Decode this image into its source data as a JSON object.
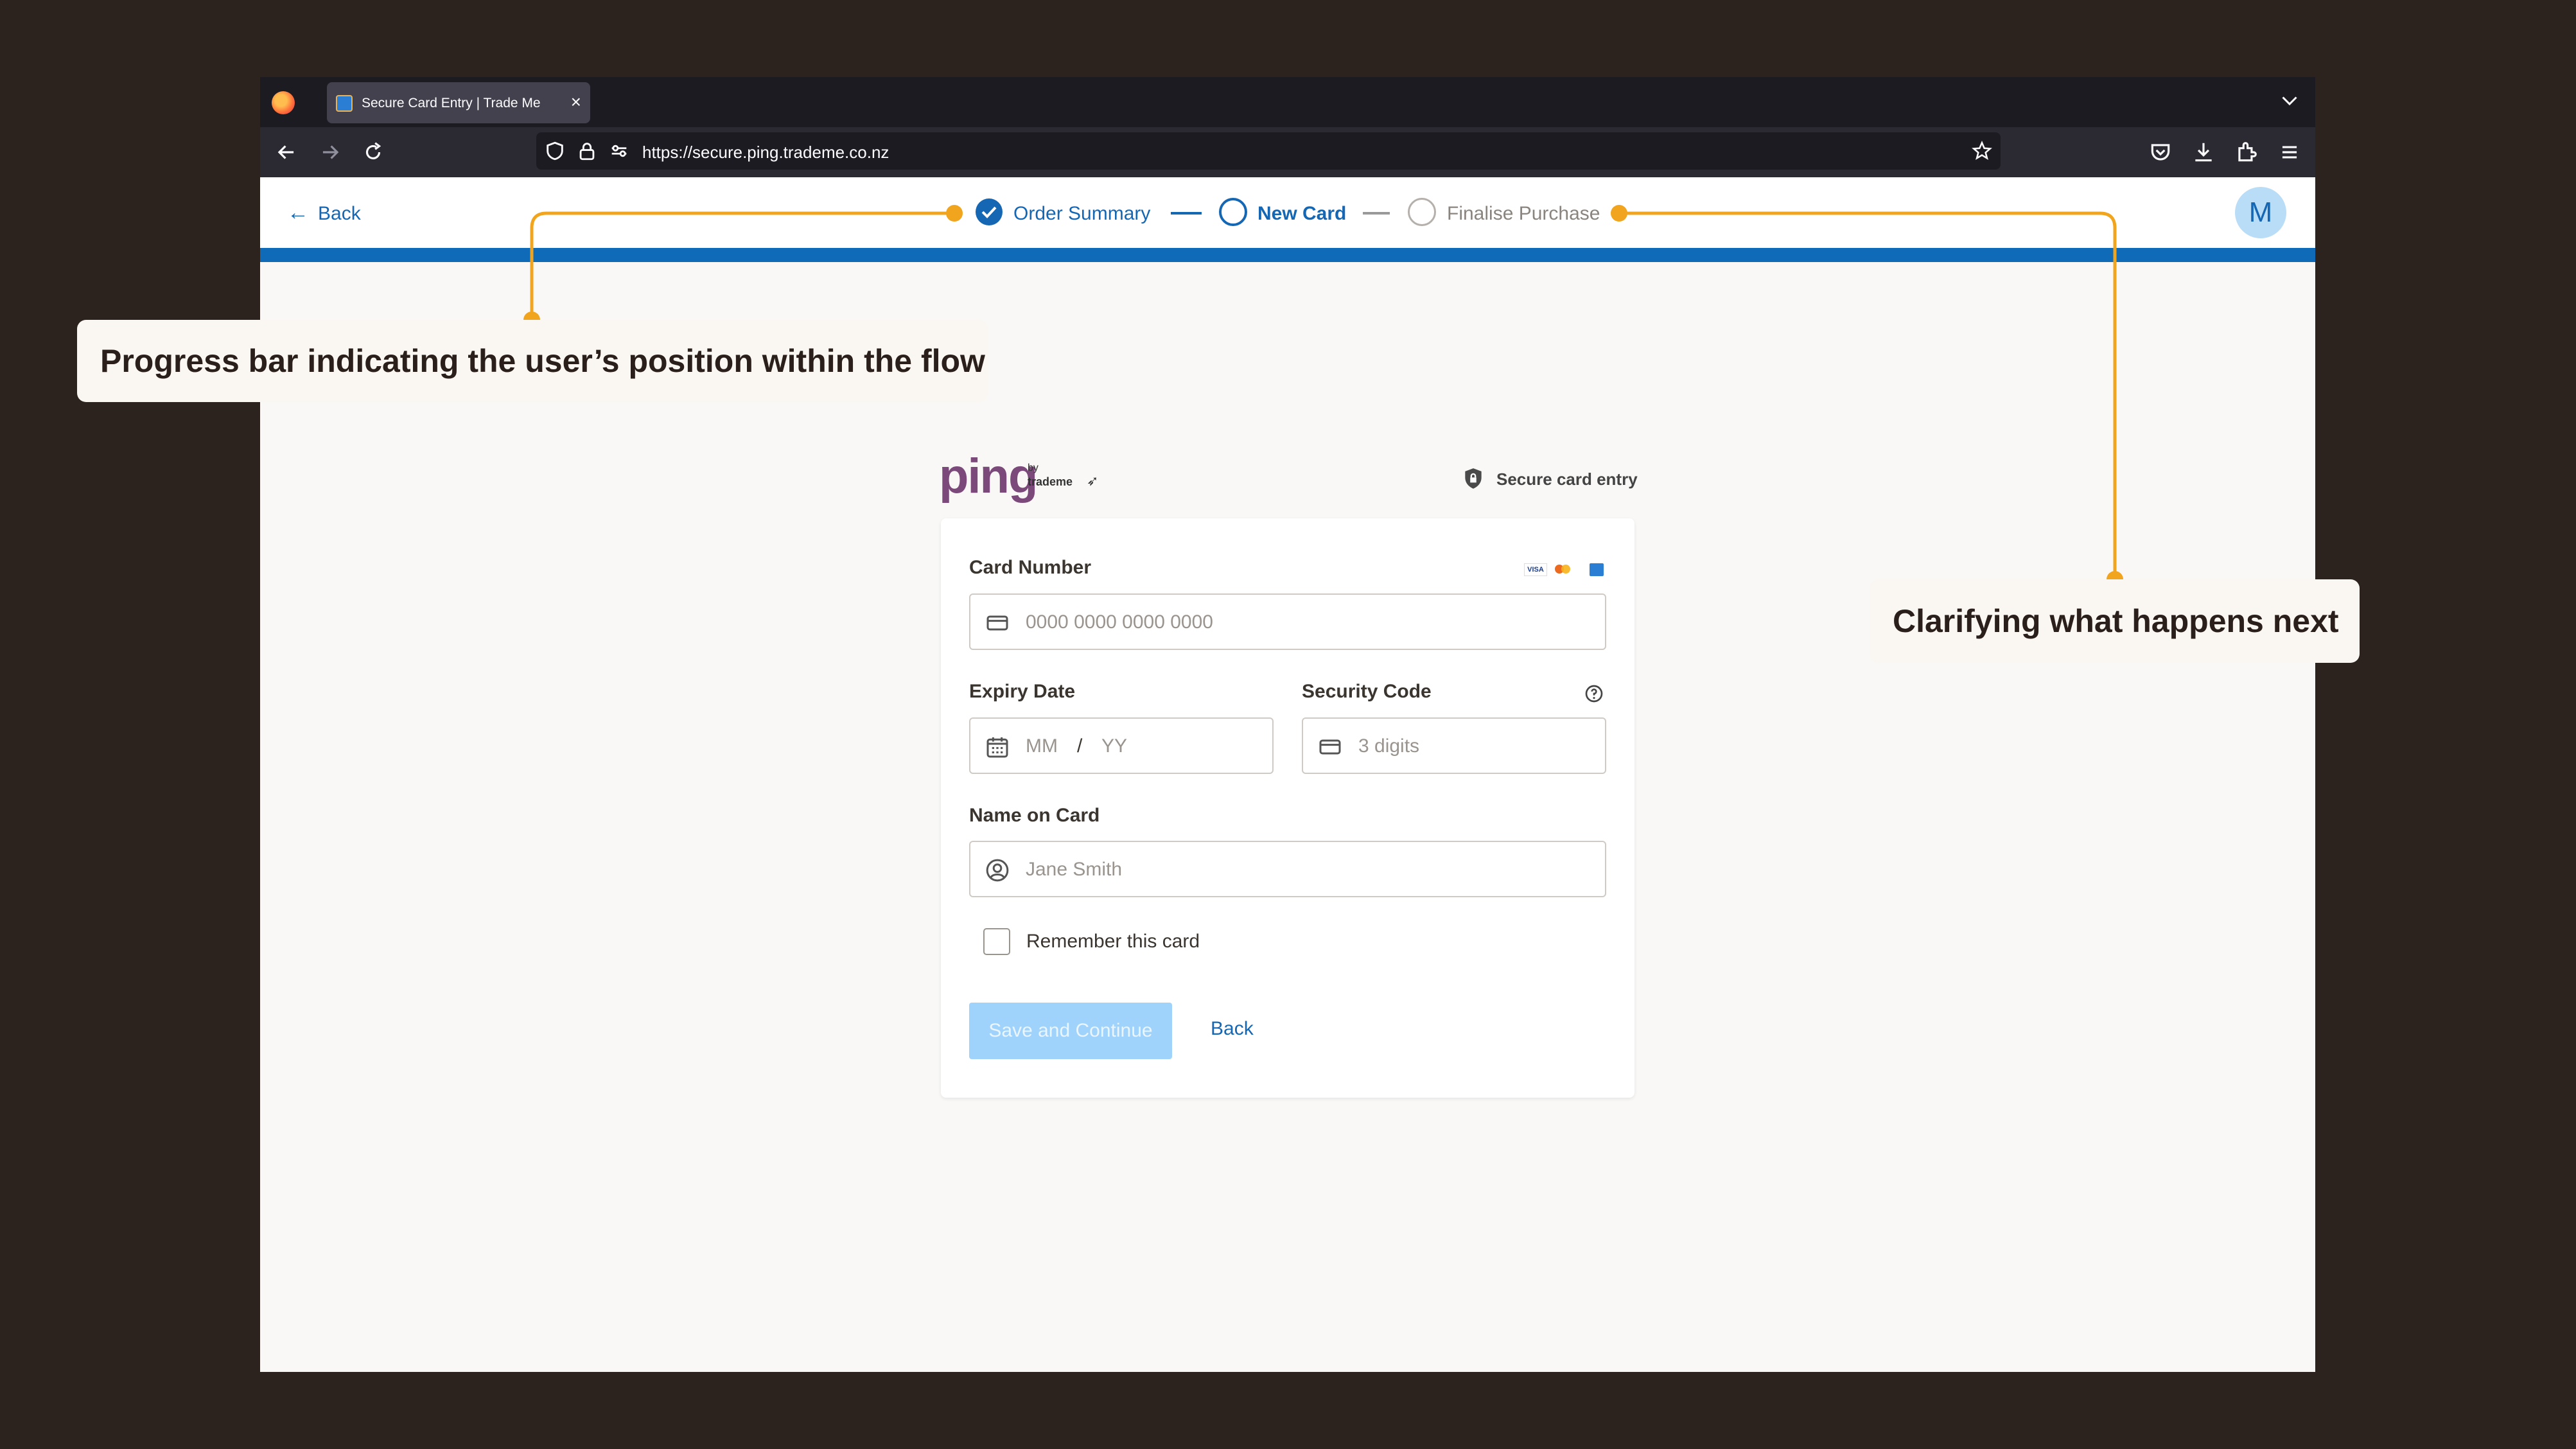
{
  "browser": {
    "tab_title": "Secure Card Entry | Trade Me",
    "tab_close": "×",
    "url": "https://secure.ping.trademe.co.nz"
  },
  "header": {
    "back_label": "Back",
    "steps": [
      {
        "label": "Order Summary",
        "state": "complete"
      },
      {
        "label": "New Card",
        "state": "current"
      },
      {
        "label": "Finalise Purchase",
        "state": "upcoming"
      }
    ],
    "avatar_initial": "M"
  },
  "brand": {
    "logo_text": "ping",
    "logo_by": "by",
    "logo_sub": "trademe",
    "secure_label": "Secure card entry"
  },
  "form": {
    "card_number": {
      "label": "Card Number",
      "placeholder": "0000 0000 0000 0000"
    },
    "card_brands": [
      "VISA",
      "Mastercard",
      "Amex"
    ],
    "expiry": {
      "label": "Expiry Date",
      "placeholder_month": "MM",
      "separator": "/",
      "placeholder_year": "YY"
    },
    "security_code": {
      "label": "Security Code",
      "placeholder": "3 digits"
    },
    "name": {
      "label": "Name on Card",
      "placeholder": "Jane Smith"
    },
    "remember_label": "Remember this card",
    "remember_checked": false,
    "save_label": "Save and Continue",
    "back_label": "Back"
  },
  "annotations": [
    {
      "text": "Progress bar indicating the user’s position within the flow"
    },
    {
      "text": "Clarifying what happens next"
    }
  ],
  "colors": {
    "backdrop": "#2d231e",
    "accent": "#1567b4",
    "callout_line": "#f1a51e",
    "button_disabled": "#9fd3fb"
  }
}
